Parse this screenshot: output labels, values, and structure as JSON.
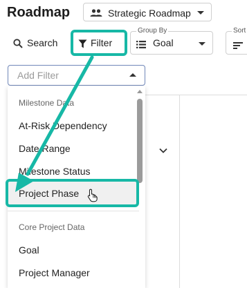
{
  "header": {
    "title": "Roadmap",
    "view_selector": {
      "label": "Strategic Roadmap",
      "icon": "people-icon"
    }
  },
  "toolbar": {
    "search_label": "Search",
    "filter_label": "Filter",
    "group_by": {
      "caption": "Group By",
      "value": "Goal"
    },
    "sort_by": {
      "caption": "Sort"
    }
  },
  "add_filter": {
    "placeholder": "Add Filter"
  },
  "menu": {
    "sections": [
      {
        "header": "Milestone Data",
        "items": [
          "At-Risk Dependency",
          "Date Range",
          "Milestone Status",
          "Project Phase"
        ]
      },
      {
        "header": "Core Project Data",
        "items": [
          "Goal",
          "Project Manager"
        ]
      }
    ],
    "highlighted_item": "Project Phase"
  },
  "colors": {
    "highlight": "#17b8a6",
    "input_border": "#6f86b8"
  }
}
